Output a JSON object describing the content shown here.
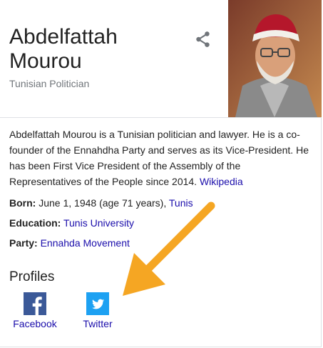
{
  "entity": {
    "name_line1": "Abdelfattah",
    "name_line2": "Mourou",
    "subtitle": "Tunisian Politician"
  },
  "description": {
    "text": "Abdelfattah Mourou is a Tunisian politician and lawyer. He is a co-founder of the Ennahdha Party and serves as its Vice-President. He has been First Vice President of the Assembly of the Representatives of the People since 2014.",
    "source_link": "Wikipedia"
  },
  "facts": {
    "born": {
      "label": "Born:",
      "value": "June 1, 1948 (age 71 years),",
      "link": "Tunis"
    },
    "education": {
      "label": "Education:",
      "link": "Tunis University"
    },
    "party": {
      "label": "Party:",
      "link": "Ennahda Movement"
    }
  },
  "profiles": {
    "title": "Profiles",
    "items": [
      {
        "label": "Facebook",
        "icon": "facebook-icon",
        "color": "#3b5998"
      },
      {
        "label": "Twitter",
        "icon": "twitter-icon",
        "color": "#1da1f2"
      }
    ]
  },
  "colors": {
    "link": "#1a0dab",
    "subtitle": "#70757a",
    "arrow": "#f5a623"
  }
}
